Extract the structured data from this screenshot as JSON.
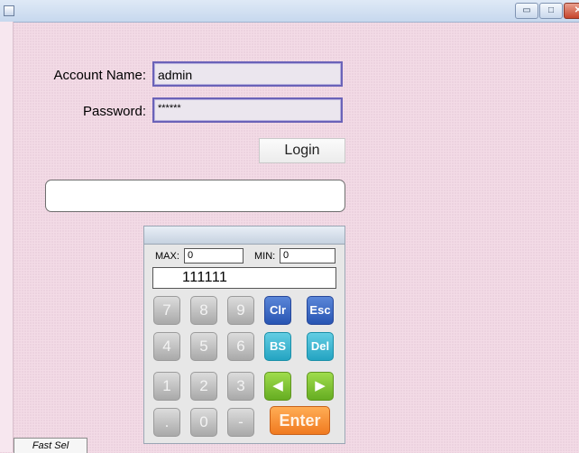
{
  "window": {
    "minimize_icon": "minimize-icon",
    "maximize_icon": "maximize-icon",
    "close_icon": "close-icon",
    "minimize_glyph": "▭",
    "maximize_glyph": "□",
    "close_glyph": "✕"
  },
  "login": {
    "account_label": "Account Name:",
    "account_value": "admin",
    "password_label": "Password:",
    "password_value": "******",
    "login_button": "Login",
    "message": ""
  },
  "keypad": {
    "max_label": "MAX:",
    "max_value": "0",
    "min_label": "MIN:",
    "min_value": "0",
    "display": "111111",
    "keys": {
      "k7": "7",
      "k8": "8",
      "k9": "9",
      "clr": "Clr",
      "esc": "Esc",
      "k4": "4",
      "k5": "5",
      "k6": "6",
      "bs": "BS",
      "del": "Del",
      "k1": "1",
      "k2": "2",
      "k3": "3",
      "left": "◀",
      "right": "▶",
      "dot": ".",
      "k0": "0",
      "minus": "-",
      "enter": "Enter"
    }
  },
  "tabs": {
    "fast_sel": "Fast Sel"
  },
  "colors": {
    "background": "#f3dbe6",
    "field_border": "#6a62b8",
    "key_blue": "#2855b3",
    "key_cyan": "#24a4c2",
    "key_green": "#66ad22",
    "key_orange": "#f07a20"
  }
}
